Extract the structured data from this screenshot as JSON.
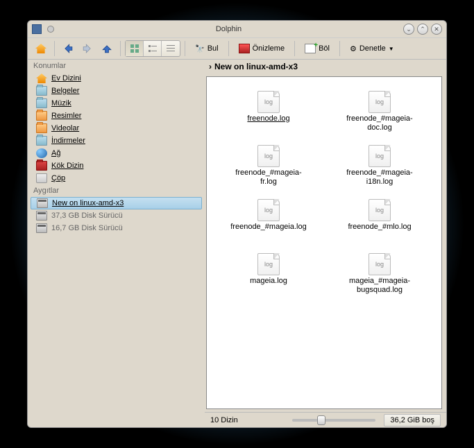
{
  "window": {
    "title": "Dolphin"
  },
  "toolbar": {
    "find": "Bul",
    "preview": "Önizleme",
    "split": "Böl",
    "control": "Denetle"
  },
  "sidebar": {
    "places_header": "Konumlar",
    "places": [
      {
        "label": "Ev Dizini",
        "icon": "home"
      },
      {
        "label": "Belgeler",
        "icon": "folder"
      },
      {
        "label": "Müzik",
        "icon": "folder"
      },
      {
        "label": "Resimler",
        "icon": "folder-orange"
      },
      {
        "label": "Videolar",
        "icon": "folder-orange"
      },
      {
        "label": "İndirmeler",
        "icon": "folder"
      },
      {
        "label": "Ağ",
        "icon": "globe"
      },
      {
        "label": "Kök Dizin",
        "icon": "folder-red"
      },
      {
        "label": "Çöp",
        "icon": "trash"
      }
    ],
    "devices_header": "Aygıtlar",
    "devices": [
      {
        "label": "New on linux-amd-x3",
        "selected": true
      },
      {
        "label": "37,3 GB Disk Sürücü"
      },
      {
        "label": "16,7 GB Disk Sürücü"
      }
    ]
  },
  "breadcrumb": {
    "current": "New on linux-amd-x3"
  },
  "files": [
    {
      "name": "freenode.log"
    },
    {
      "name": "freenode_#mageia-doc.log"
    },
    {
      "name": "freenode_#mageia-fr.log"
    },
    {
      "name": "freenode_#mageia-i18n.log"
    },
    {
      "name": "freenode_#mageia.log"
    },
    {
      "name": "freenode_#mlo.log"
    },
    {
      "name": "mageia.log"
    },
    {
      "name": "mageia_#mageia-bugsquad.log"
    }
  ],
  "statusbar": {
    "count": "10 Dizin",
    "freespace": "36,2 GiB boş"
  },
  "file_icon_text": "log"
}
